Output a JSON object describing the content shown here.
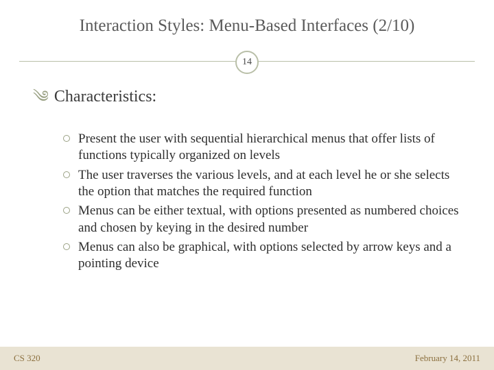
{
  "title": "Interaction Styles: Menu-Based Interfaces (2/10)",
  "page_number": "14",
  "section_heading": "Characteristics:",
  "bullets": [
    "Present the user with sequential hierarchical menus that offer lists of functions typically organized on levels",
    "The user traverses the various levels, and at each level he or she selects the option that matches the required function",
    "Menus can be either textual, with options presented as numbered choices and chosen by keying in the desired number",
    "Menus can also be graphical, with options selected by arrow keys and a pointing device"
  ],
  "footer": {
    "left": "CS 320",
    "right": "February 14, 2011"
  }
}
